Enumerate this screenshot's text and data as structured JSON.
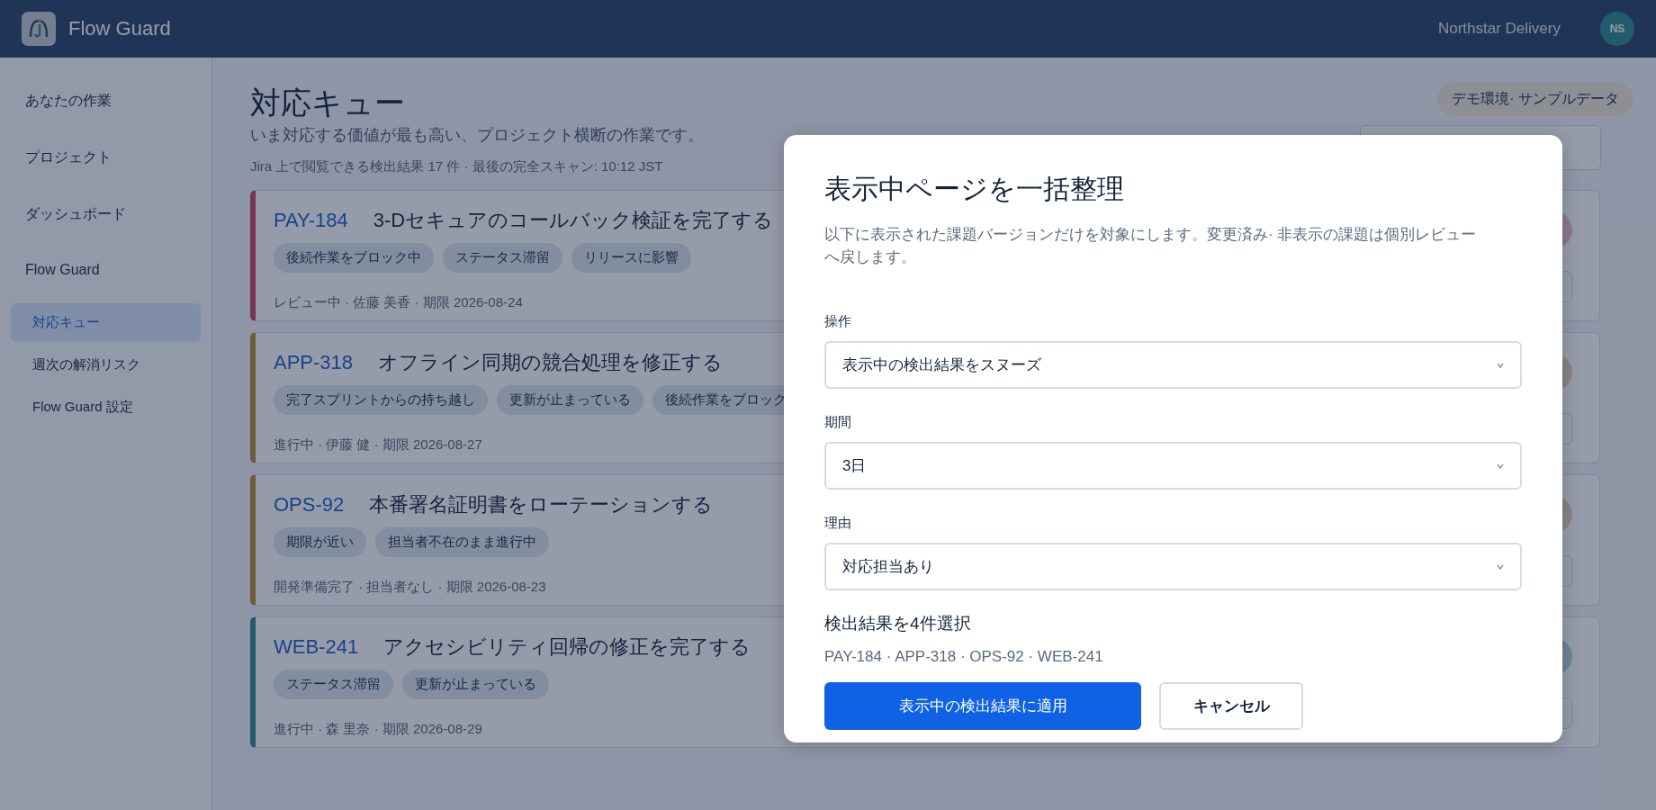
{
  "app": {
    "name": "Flow Guard",
    "workspace": "Northstar Delivery",
    "avatar": "NS"
  },
  "sidebar": {
    "items": [
      {
        "label": "あなたの作業",
        "selected": false
      },
      {
        "label": "プロジェクト",
        "selected": false
      },
      {
        "label": "ダッシュボード",
        "selected": false
      },
      {
        "label": "Flow Guard",
        "selected": false,
        "children": [
          {
            "label": "対応キュー",
            "selected": true
          },
          {
            "label": "週次の解消リスク",
            "selected": false
          },
          {
            "label": "Flow Guard 設定",
            "selected": false
          }
        ]
      }
    ]
  },
  "page": {
    "title": "対応キュー",
    "subtitle": "いま対応する価値が最も高い、プロジェクト横断の作業です。",
    "meta": "Jira 上で閲覧できる検出結果 17 件 · 最後の完全スキャン: 10:12 JST",
    "badge": "デモ環境· サンプルデータ"
  },
  "cards": [
    {
      "key": "PAY-184",
      "title": "3-Dセキュアのコールバック検証を完了する",
      "kind": "critical",
      "tags": [
        "後続作業をブロック中",
        "ステータス滞留",
        "リリースに影響"
      ],
      "meta": "レビュー中 · 佐藤 美香 · 期限 2026-08-24"
    },
    {
      "key": "APP-318",
      "title": "オフライン同期の競合処理を修正する",
      "kind": "warning",
      "tags": [
        "完了スプリントからの持ち越し",
        "更新が止まっている",
        "後続作業をブロック"
      ],
      "meta": "進行中 · 伊藤 健 · 期限 2026-08-27"
    },
    {
      "key": "OPS-92",
      "title": "本番署名証明書をローテーションする",
      "kind": "warning",
      "tags": [
        "期限が近い",
        "担当者不在のまま進行中"
      ],
      "meta": "開発準備完了 · 担当者なし · 期限 2026-08-23"
    },
    {
      "key": "WEB-241",
      "title": "アクセシビリティ回帰の修正を完了する",
      "kind": "info",
      "tags": [
        "ステータス滞留",
        "更新が止まっている"
      ],
      "meta": "進行中 · 森 里奈 · 期限 2026-08-29"
    }
  ],
  "dialog": {
    "title": "表示中ページを一括整理",
    "description": "以下に表示された課題バージョンだけを対象にします。変更済み· 非表示の課題は個別レビューへ戻します。",
    "fields": [
      {
        "label": "操作",
        "value": "表示中の検出結果をスヌーズ"
      },
      {
        "label": "期間",
        "value": "3日"
      },
      {
        "label": "理由",
        "value": "対応担当あり"
      }
    ],
    "selection_title": "検出結果を4件選択",
    "selection": "PAY-184 · APP-318 · OPS-92 · WEB-241",
    "buttons": [
      {
        "label": "表示中の検出結果に適用",
        "kind": "primary"
      },
      {
        "label": "キャンセル",
        "kind": "secondary"
      }
    ]
  }
}
